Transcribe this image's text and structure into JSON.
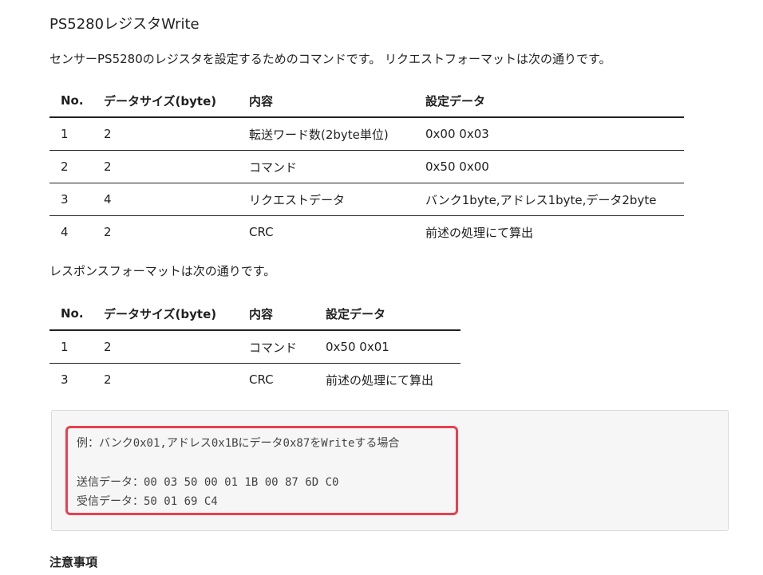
{
  "title": "PS5280レジスタWrite",
  "intro": "センサーPS5280のレジスタを設定するためのコマンドです。 リクエストフォーマットは次の通りです。",
  "request_table": {
    "headers": [
      "No.",
      "データサイズ(byte)",
      "内容",
      "設定データ"
    ],
    "rows": [
      [
        "1",
        "2",
        "転送ワード数(2byte単位)",
        "0x00 0x03"
      ],
      [
        "2",
        "2",
        "コマンド",
        "0x50 0x00"
      ],
      [
        "3",
        "4",
        "リクエストデータ",
        "バンク1byte,アドレス1byte,データ2byte"
      ],
      [
        "4",
        "2",
        "CRC",
        "前述の処理にて算出"
      ]
    ]
  },
  "response_intro": "レスポンスフォーマットは次の通りです。",
  "response_table": {
    "headers": [
      "No.",
      "データサイズ(byte)",
      "内容",
      "設定データ"
    ],
    "rows": [
      [
        "1",
        "2",
        "コマンド",
        "0x50 0x01"
      ],
      [
        "3",
        "2",
        "CRC",
        "前述の処理にて算出"
      ]
    ]
  },
  "example": {
    "line": "例：バンク0x01,アドレス0x1Bにデータ0x87をWriteする場合",
    "send": "送信データ：00 03 50 00 01 1B 00 87 6D C0",
    "recv": "受信データ：50 01 69 C4",
    "highlight_color": "#e8404f"
  },
  "notes_heading": "注意事項"
}
